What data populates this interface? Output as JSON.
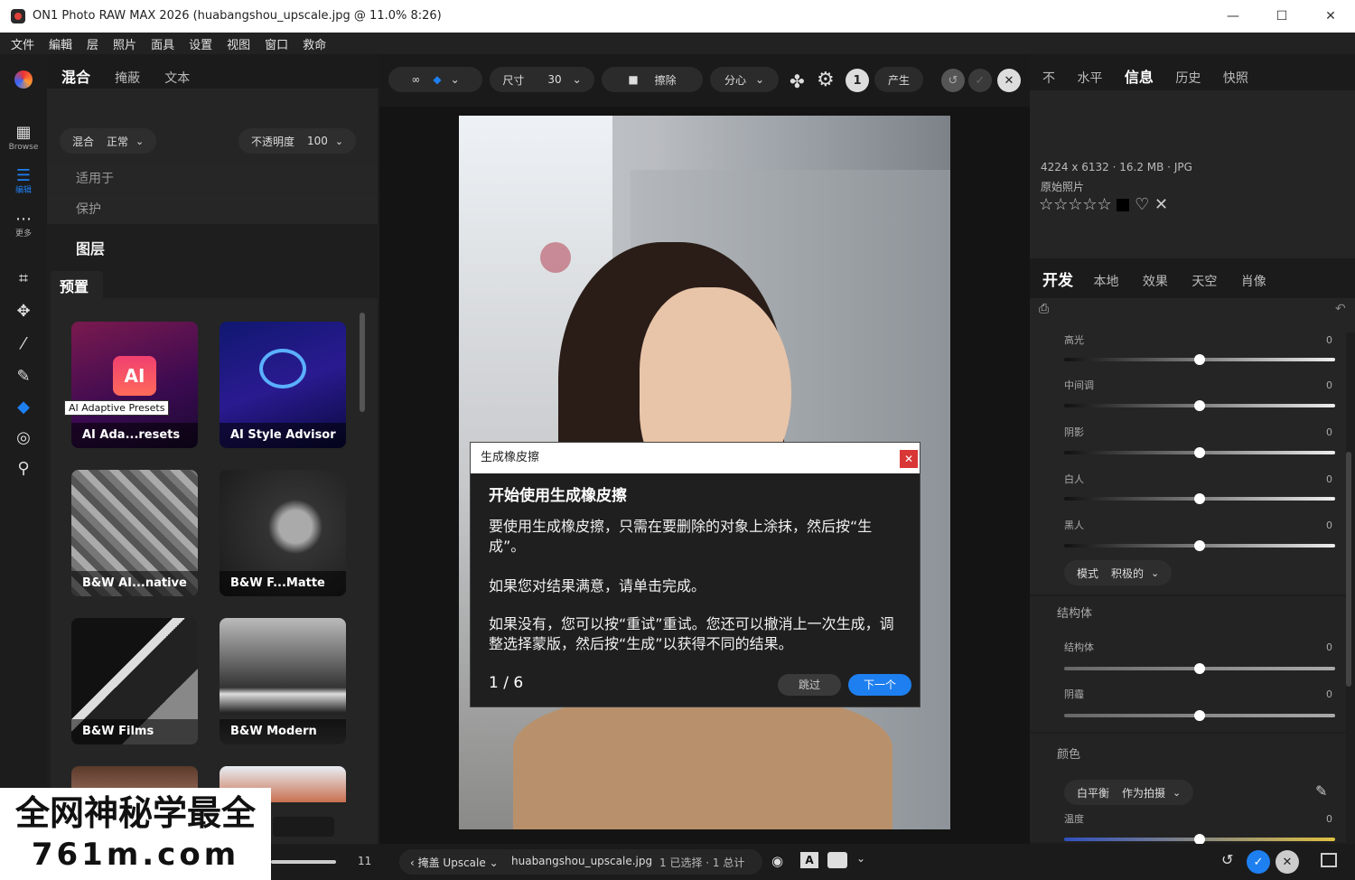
{
  "window": {
    "title": "ON1 Photo RAW MAX 2026 (huabangshou_upscale.jpg @ 11.0% 8:26)"
  },
  "menu": [
    "文件",
    "編輯",
    "层",
    "照片",
    "面具",
    "设置",
    "视图",
    "窗口",
    "救命"
  ],
  "tools": [
    {
      "icon": "grid-icon",
      "label": "Browse"
    },
    {
      "icon": "sliders-icon",
      "label": "编辑"
    },
    {
      "icon": "more-icon",
      "label": "更多"
    }
  ],
  "left_panel": {
    "tabs": [
      "混合",
      "掩蔽",
      "文本"
    ],
    "blend": {
      "label": "混合",
      "value": "正常"
    },
    "opacity": {
      "label": "不透明度",
      "value": "100"
    },
    "apply_to": "适用于",
    "protect": "保护",
    "layers": "图层",
    "presets": "预置",
    "tooltip": "AI Adaptive Presets",
    "cards": [
      {
        "label": "AI Ada...resets",
        "badge": "AI"
      },
      {
        "label": "AI Style Advisor"
      },
      {
        "label": "B&W AI...native"
      },
      {
        "label": "B&W F...Matte"
      },
      {
        "label": "B&W Films"
      },
      {
        "label": "B&W Modern"
      }
    ],
    "bottom_count": "11"
  },
  "toolbar": {
    "size_label": "尺寸",
    "size_value": "30",
    "erase_label": "擦除",
    "mode_label": "分心",
    "info_icon": "1",
    "produce_label": "产生"
  },
  "dialog": {
    "title": "生成橡皮擦",
    "heading": "开始使用生成橡皮擦",
    "p1": "要使用生成橡皮擦，只需在要删除的对象上涂抹，然后按“生成”。",
    "p2": "如果您对结果满意，请单击完成。",
    "p3": "如果没有，您可以按“重试”重试。您还可以撤消上一次生成，调整选择蒙版，然后按“生成”以获得不同的结果。",
    "page": "1 / 6",
    "skip_label": "跳过",
    "next_label": "下一个"
  },
  "right_panel": {
    "tabs": [
      "不",
      "水平",
      "信息",
      "历史",
      "快照"
    ],
    "info": {
      "dims": "4224 x 6132 · 16.2 MB · JPG",
      "subtitle": "原始照片",
      "stars": "☆☆☆☆☆"
    },
    "dev_tabs": [
      "开发",
      "本地",
      "效果",
      "天空",
      "肖像"
    ],
    "sliders": [
      {
        "label": "高光",
        "value": "0"
      },
      {
        "label": "中间调",
        "value": "0"
      },
      {
        "label": "阴影",
        "value": "0"
      },
      {
        "label": "白人",
        "value": "0"
      },
      {
        "label": "黑人",
        "value": "0"
      }
    ],
    "mode": {
      "label": "模式",
      "value": "积极的"
    },
    "structure_title": "结构体",
    "structure_sliders": [
      {
        "label": "结构体",
        "value": "0"
      },
      {
        "label": "阴霾",
        "value": "0"
      }
    ],
    "color_title": "颜色",
    "wb": {
      "label": "白平衡",
      "value": "作为拍摄"
    },
    "temp": {
      "label": "温度",
      "value": "0"
    }
  },
  "bottom": {
    "nav": "‹ 掩盖 Upscale ⌄",
    "filename": "huabangshou_upscale.jpg",
    "selection": "1 已选择 · 1 总计"
  },
  "watermark": {
    "line1": "全网神秘学最全",
    "line2": "761m.com"
  },
  "colors": {
    "accent": "#1e7ff0",
    "close": "#d93636",
    "background": "#1a1a1a"
  }
}
